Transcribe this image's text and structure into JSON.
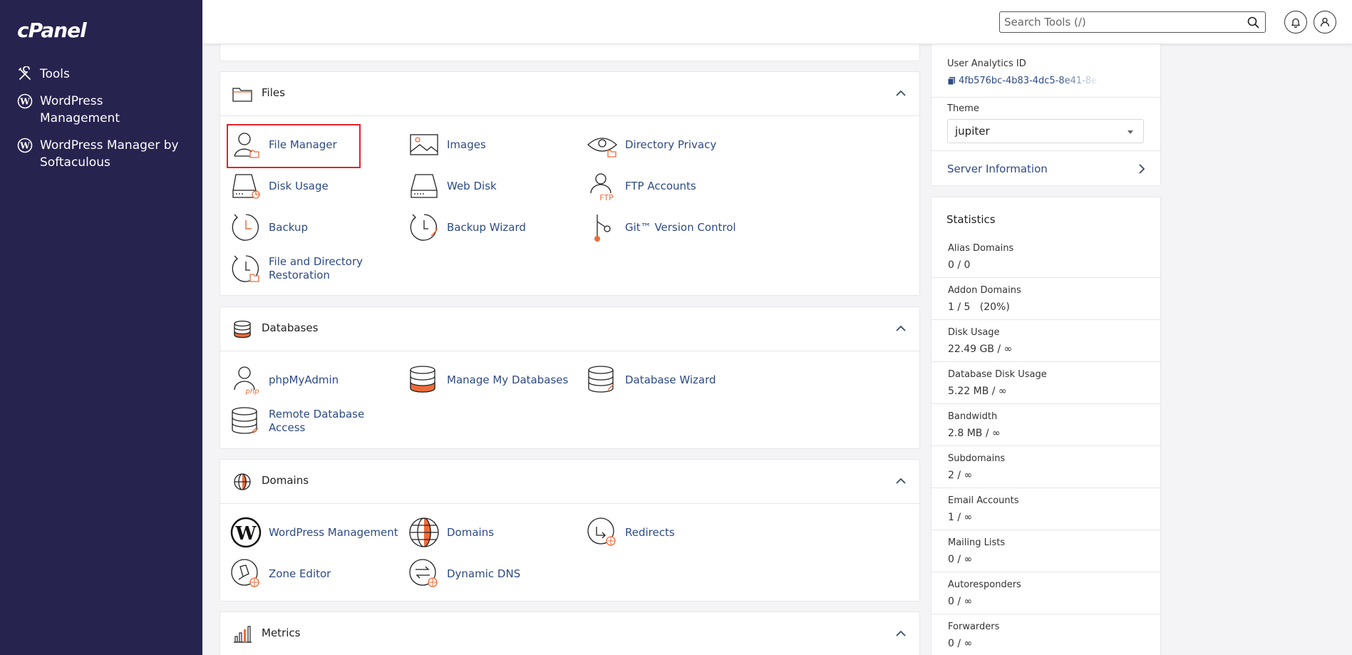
{
  "brand": {
    "logo_text": "cPanel"
  },
  "sidebar": {
    "items": [
      {
        "label": "Tools",
        "icon": "tools-icon"
      },
      {
        "label": "WordPress Management",
        "icon": "wordpress-icon"
      },
      {
        "label": "WordPress Manager by Softaculous",
        "icon": "wordpress-icon"
      }
    ]
  },
  "header": {
    "search_placeholder": "Search Tools (/)",
    "icons": [
      "search-icon",
      "bell-icon",
      "user-icon"
    ]
  },
  "sections": {
    "files": {
      "title": "Files",
      "tools": [
        {
          "label": "File Manager",
          "icon": "file-manager-icon",
          "highlighted": true
        },
        {
          "label": "Images",
          "icon": "images-icon"
        },
        {
          "label": "Directory Privacy",
          "icon": "directory-privacy-icon"
        },
        {
          "label": "Disk Usage",
          "icon": "disk-usage-icon"
        },
        {
          "label": "Web Disk",
          "icon": "web-disk-icon"
        },
        {
          "label": "FTP Accounts",
          "icon": "ftp-accounts-icon"
        },
        {
          "label": "Backup",
          "icon": "backup-icon"
        },
        {
          "label": "Backup Wizard",
          "icon": "backup-wizard-icon"
        },
        {
          "label": "Git™ Version Control",
          "icon": "git-icon"
        },
        {
          "label": "File and Directory Restoration",
          "icon": "restoration-icon"
        }
      ]
    },
    "databases": {
      "title": "Databases",
      "tools": [
        {
          "label": "phpMyAdmin",
          "icon": "phpmyadmin-icon"
        },
        {
          "label": "Manage My Databases",
          "icon": "manage-databases-icon"
        },
        {
          "label": "Database Wizard",
          "icon": "database-wizard-icon"
        },
        {
          "label": "Remote Database Access",
          "icon": "remote-database-icon"
        }
      ]
    },
    "domains": {
      "title": "Domains",
      "tools": [
        {
          "label": "WordPress Management",
          "icon": "wordpress-icon"
        },
        {
          "label": "Domains",
          "icon": "domains-globe-icon"
        },
        {
          "label": "Redirects",
          "icon": "redirects-icon"
        },
        {
          "label": "Zone Editor",
          "icon": "zone-editor-icon"
        },
        {
          "label": "Dynamic DNS",
          "icon": "dynamic-dns-icon"
        }
      ]
    },
    "metrics": {
      "title": "Metrics"
    }
  },
  "account": {
    "analytics_label": "User Analytics ID",
    "analytics_value": "4fb576bc-4b83-4dc5-8e41-8e...",
    "theme_label": "Theme",
    "theme_value": "jupiter",
    "server_info_label": "Server Information"
  },
  "statistics": {
    "title": "Statistics",
    "rows": [
      {
        "label": "Alias Domains",
        "value": "0 / 0"
      },
      {
        "label": "Addon Domains",
        "value": "1 / 5   (20%)"
      },
      {
        "label": "Disk Usage",
        "value": "22.49 GB / ∞"
      },
      {
        "label": "Database Disk Usage",
        "value": "5.22 MB / ∞"
      },
      {
        "label": "Bandwidth",
        "value": "2.8 MB / ∞"
      },
      {
        "label": "Subdomains",
        "value": "2 / ∞"
      },
      {
        "label": "Email Accounts",
        "value": "1 / ∞"
      },
      {
        "label": "Mailing Lists",
        "value": "0 / ∞"
      },
      {
        "label": "Autoresponders",
        "value": "0 / ∞"
      },
      {
        "label": "Forwarders",
        "value": "0 / ∞"
      }
    ]
  },
  "colors": {
    "sidebar_bg": "#27234f",
    "link": "#2d4a87",
    "accent": "#ef6b3a",
    "highlight": "#e4222a"
  }
}
